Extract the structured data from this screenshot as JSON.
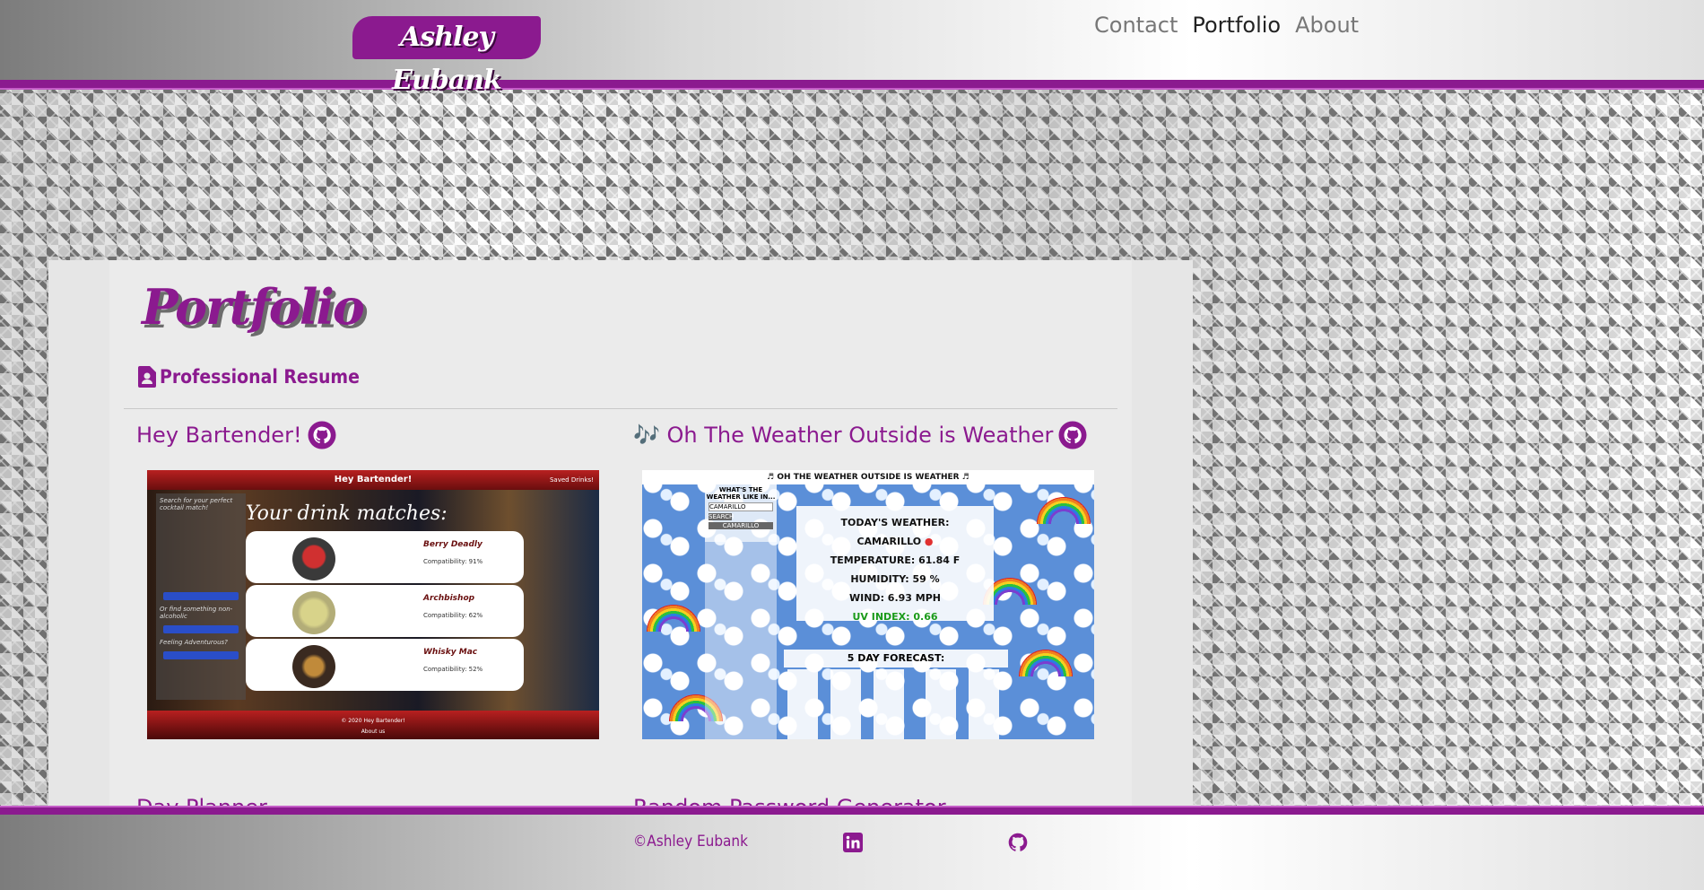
{
  "header": {
    "logo_text": "Ashley Eubank",
    "nav": [
      {
        "label": "Contact",
        "active": false
      },
      {
        "label": "Portfolio",
        "active": true
      },
      {
        "label": "About",
        "active": false
      }
    ]
  },
  "colors": {
    "brand": "#8b1a8f",
    "nav_inactive": "#777777",
    "nav_active": "#222222"
  },
  "main": {
    "title": "Portfolio",
    "resume_label": "Professional Resume",
    "resume_icon": "person-file-icon",
    "projects": [
      {
        "title": "Hey Bartender!",
        "icon": "github-icon",
        "screenshot": {
          "app_title": "Hey Bartender!",
          "saved": "Saved Drinks!",
          "heading": "Your drink matches:",
          "side_text": "Search for your perfect cocktail match!",
          "side_text_2": "Or find something non-alcoholic",
          "side_text_3": "Feeling Adventurous?",
          "drinks": [
            {
              "name": "Berry Deadly",
              "compat": "Compatibility: 91%"
            },
            {
              "name": "Archbishop",
              "compat": "Compatibility: 62%"
            },
            {
              "name": "Whisky Mac",
              "compat": "Compatibility: 52%"
            }
          ],
          "footer_1": "© 2020 Hey Bartender!",
          "footer_2": "About us"
        }
      },
      {
        "title": "🎶 Oh The Weather Outside is Weather",
        "icon": "github-icon",
        "screenshot": {
          "app_title": "♬ OH THE WEATHER OUTSIDE IS WEATHER ♬",
          "search_heading": "WHAT'S THE WEATHER LIKE IN...",
          "search_value": "CAMARILLO",
          "search_button": "SEARCH",
          "history": "CAMARILLO",
          "today_heading": "TODAY'S WEATHER:",
          "city": "CAMARILLO",
          "temperature": "TEMPERATURE: 61.84 F",
          "humidity": "HUMIDITY: 59 %",
          "wind": "WIND: 6.93 MPH",
          "uv": "UV INDEX: 0.66",
          "forecast_heading": "5 DAY FORECAST:"
        }
      }
    ],
    "next_row": [
      {
        "title": "Day Planner"
      },
      {
        "title": "Random Password Generator"
      }
    ]
  },
  "footer": {
    "copyright": "©Ashley Eubank",
    "icons": [
      "linkedin-icon",
      "github-icon"
    ]
  }
}
